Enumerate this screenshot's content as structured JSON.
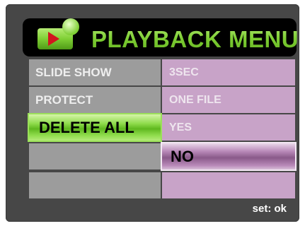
{
  "menu": {
    "title": "PLAYBACK MENU",
    "icon": "playback-icon",
    "accent_color": "#7fcf35",
    "highlight_color": "#8fdc4c",
    "value_color": "#c8a3c8",
    "rows": [
      {
        "label": "SLIDE SHOW",
        "value": "3SEC"
      },
      {
        "label": "PROTECT",
        "value": "ONE FILE"
      },
      {
        "label": "DELETE ALL",
        "value": "YES"
      },
      {
        "label": "",
        "value": "NO"
      },
      {
        "label": "",
        "value": ""
      }
    ],
    "selected_row": "DELETE ALL",
    "selected_option": "NO"
  },
  "footer": {
    "hint": "set: ok"
  }
}
